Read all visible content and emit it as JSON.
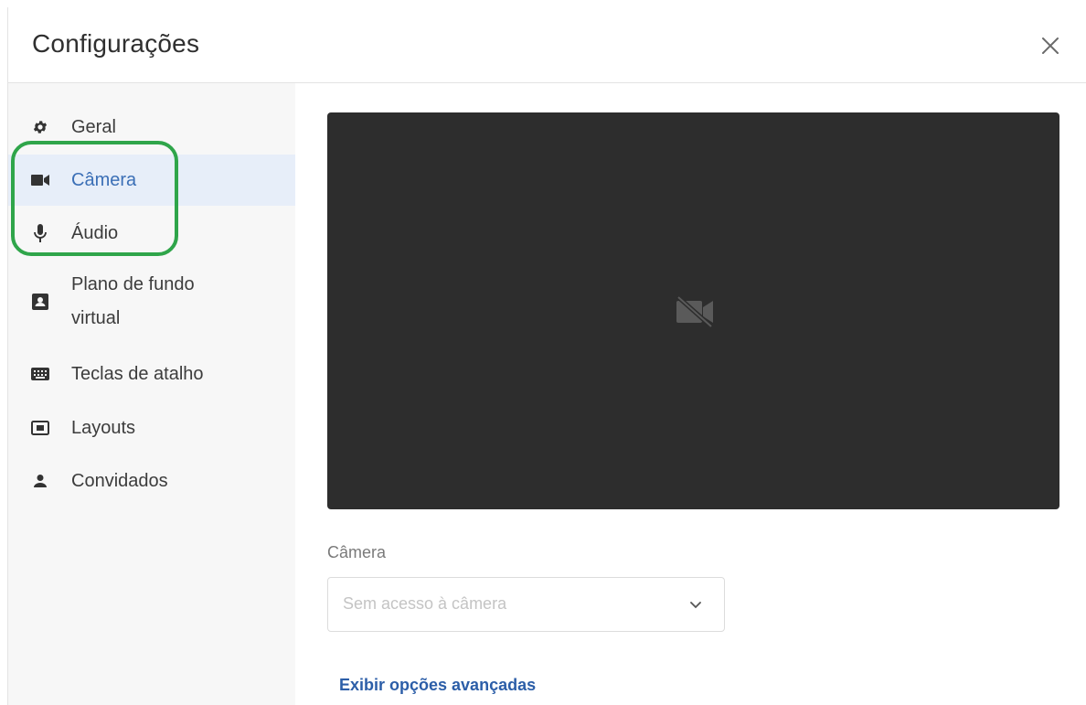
{
  "header": {
    "title": "Configurações",
    "close_icon": "close-icon"
  },
  "sidebar": {
    "items": [
      {
        "label": "Geral",
        "icon": "gear-icon"
      },
      {
        "label": "Câmera",
        "icon": "video-camera-icon",
        "active": true
      },
      {
        "label": "Áudio",
        "icon": "microphone-icon"
      },
      {
        "label_line1": "Plano de fundo",
        "label_line2": "virtual",
        "icon": "portrait-background-icon"
      },
      {
        "label": "Teclas de atalho",
        "icon": "keyboard-icon"
      },
      {
        "label": "Layouts",
        "icon": "layout-icon"
      },
      {
        "label": "Convidados",
        "icon": "person-icon"
      }
    ]
  },
  "main": {
    "preview_icon": "camera-off-icon",
    "camera_field": {
      "label": "Câmera",
      "selected": "Sem acesso à câmera"
    },
    "advanced_link": "Exibir opções avançadas"
  },
  "colors": {
    "accent": "#3b6fb6",
    "active_bg": "#e7eef9",
    "highlight_ring": "#2fa54a",
    "preview_bg": "#2d2d2d"
  }
}
